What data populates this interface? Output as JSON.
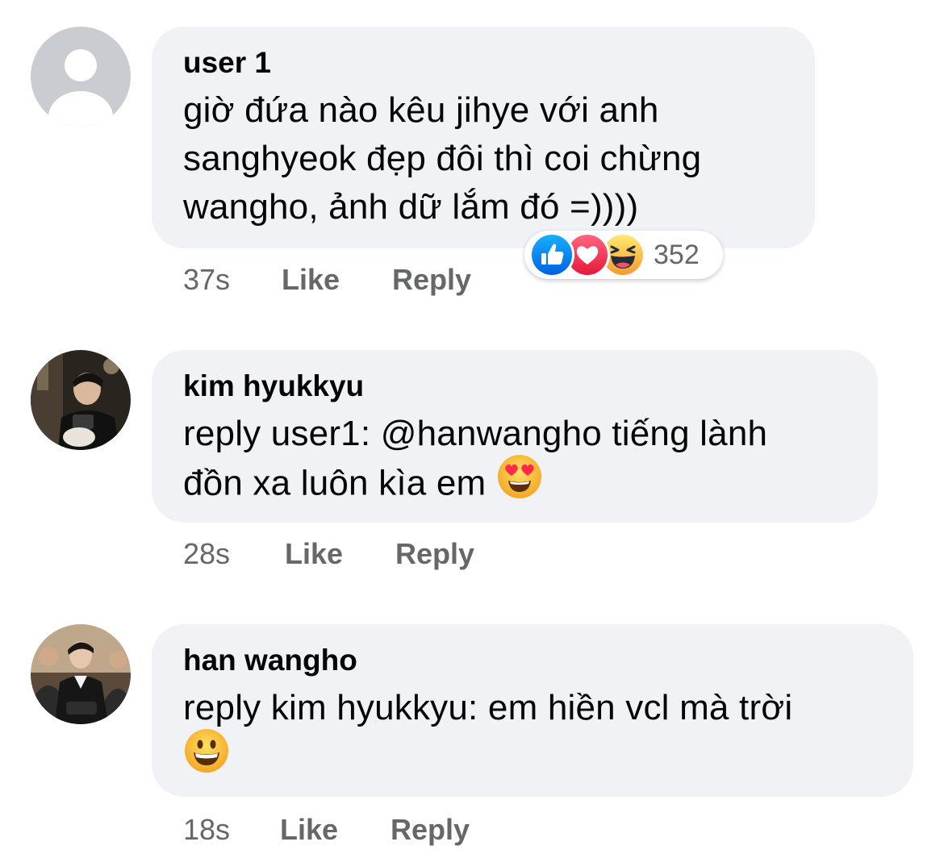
{
  "comments": [
    {
      "author": "user 1",
      "text": "giờ đứa nào kêu jihye với anh\nsanghyeok đẹp đôi thì coi chừng\nwangho, ảnh dữ lắm đó =))))",
      "time": "37s",
      "like_label": "Like",
      "reply_label": "Reply",
      "reactions": {
        "icons": [
          "like-icon",
          "love-icon",
          "haha-icon"
        ],
        "count": "352"
      }
    },
    {
      "author": "kim hyukkyu",
      "text": "reply user1: @hanwangho tiếng lành\nđồn xa luôn kìa em",
      "emoji": "heart-eyes-emoji",
      "time": "28s",
      "like_label": "Like",
      "reply_label": "Reply"
    },
    {
      "author": "han wangho",
      "text": "reply kim hyukkyu: em hiền vcl mà trời",
      "emoji": "grinning-face-emoji",
      "time": "18s",
      "like_label": "Like",
      "reply_label": "Reply"
    }
  ],
  "colors": {
    "bubble": "#f0f2f5",
    "meta_text": "#65676b",
    "like_blue": "#1877f2",
    "love_red": "#f33e58",
    "haha_yellow": "#f7b125"
  }
}
